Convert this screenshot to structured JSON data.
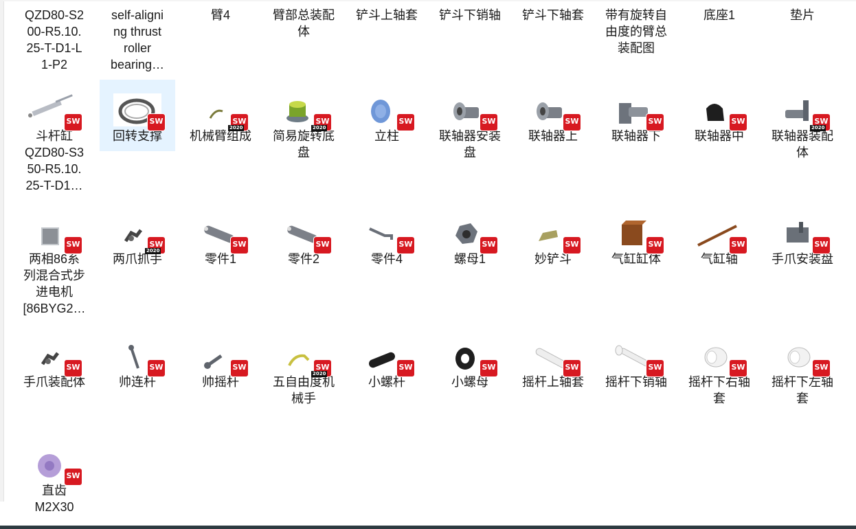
{
  "files": [
    {
      "label": "QZD80-S200-R5.10.25-T-D1-L1-P2",
      "display": "QZD80-S2\n00-R5.10.\n25-T-D1-L\n1-P2",
      "thumb": "none",
      "badge": "",
      "row": 0,
      "col": 0
    },
    {
      "label": "self-aligning thrust roller bearing…",
      "display": "self-aligni\nng thrust\nroller\nbearing…",
      "thumb": "none",
      "badge": "",
      "row": 0,
      "col": 1
    },
    {
      "label": "臂4",
      "display": "臂4",
      "thumb": "none",
      "badge": "",
      "row": 0,
      "col": 2
    },
    {
      "label": "臂部总装配体",
      "display": "臂部总装配\n体",
      "thumb": "none",
      "badge": "",
      "row": 0,
      "col": 3
    },
    {
      "label": "铲斗上轴套",
      "display": "铲斗上轴套",
      "thumb": "none",
      "badge": "",
      "row": 0,
      "col": 4
    },
    {
      "label": "铲斗下销轴",
      "display": "铲斗下销轴",
      "thumb": "none",
      "badge": "",
      "row": 0,
      "col": 5
    },
    {
      "label": "铲斗下轴套",
      "display": "铲斗下轴套",
      "thumb": "none",
      "badge": "",
      "row": 0,
      "col": 6
    },
    {
      "label": "带有旋转自由度的臂总装配图",
      "display": "带有旋转自\n由度的臂总\n装配图",
      "thumb": "none",
      "badge": "",
      "row": 0,
      "col": 7
    },
    {
      "label": "底座1",
      "display": "底座1",
      "thumb": "none",
      "badge": "",
      "row": 0,
      "col": 8
    },
    {
      "label": "垫片",
      "display": "垫片",
      "thumb": "none",
      "badge": "",
      "row": 0,
      "col": 9
    },
    {
      "label": "斗杆缸QZD80-S350-R5.10.25-T-D1…",
      "display": "斗杆缸\nQZD80-S3\n50-R5.10.\n25-T-D1…",
      "thumb": "cylinder-rod",
      "badge": "",
      "row": 1,
      "col": 0
    },
    {
      "label": "回转支撑",
      "display": "回转支撑",
      "thumb": "ring",
      "badge": "",
      "row": 1,
      "col": 1,
      "selected": true
    },
    {
      "label": "机械臂组成",
      "display": "机械臂组成",
      "thumb": "arm-thin",
      "badge": "2020",
      "row": 1,
      "col": 2
    },
    {
      "label": "简易旋转底盘",
      "display": "简易旋转底\n盘",
      "thumb": "base-green",
      "badge": "2020",
      "row": 1,
      "col": 3
    },
    {
      "label": "立柱",
      "display": "立柱",
      "thumb": "disc-blue",
      "badge": "",
      "row": 1,
      "col": 4
    },
    {
      "label": "联轴器安装盘",
      "display": "联轴器安装\n盘",
      "thumb": "coupling",
      "badge": "",
      "row": 1,
      "col": 5
    },
    {
      "label": "联轴器上",
      "display": "联轴器上",
      "thumb": "coupling",
      "badge": "",
      "row": 1,
      "col": 6
    },
    {
      "label": "联轴器下",
      "display": "联轴器下",
      "thumb": "coupling-plate",
      "badge": "",
      "row": 1,
      "col": 7
    },
    {
      "label": "联轴器中",
      "display": "联轴器中",
      "thumb": "coupling-black",
      "badge": "",
      "row": 1,
      "col": 8
    },
    {
      "label": "联轴器装配体",
      "display": "联轴器装配\n体",
      "thumb": "coupling-assembly",
      "badge": "2020",
      "row": 1,
      "col": 9
    },
    {
      "label": "两相86系列混合式步进电机[86BYG2…",
      "display": "两相86系\n列混合式步\n进电机\n[86BYG2…",
      "thumb": "motor",
      "badge": "",
      "row": 2,
      "col": 0
    },
    {
      "label": "两爪抓手",
      "display": "两爪抓手",
      "thumb": "gripper",
      "badge": "2020",
      "row": 2,
      "col": 1
    },
    {
      "label": "零件1",
      "display": "零件1",
      "thumb": "link-bar",
      "badge": "",
      "row": 2,
      "col": 2
    },
    {
      "label": "零件2",
      "display": "零件2",
      "thumb": "link-bar",
      "badge": "",
      "row": 2,
      "col": 3
    },
    {
      "label": "零件4",
      "display": "零件4",
      "thumb": "bent-plate",
      "badge": "",
      "row": 2,
      "col": 4
    },
    {
      "label": "螺母1",
      "display": "螺母1",
      "thumb": "hex-nut",
      "badge": "",
      "row": 2,
      "col": 5
    },
    {
      "label": "妙铲斗",
      "display": "妙铲斗",
      "thumb": "bucket",
      "badge": "",
      "row": 2,
      "col": 6
    },
    {
      "label": "气缸缸体",
      "display": "气缸缸体",
      "thumb": "brown-block",
      "badge": "",
      "row": 2,
      "col": 7
    },
    {
      "label": "气缸轴",
      "display": "气缸轴",
      "thumb": "brown-rod",
      "badge": "",
      "row": 2,
      "col": 8
    },
    {
      "label": "手爪安装盘",
      "display": "手爪安装盘",
      "thumb": "mount-plate",
      "badge": "",
      "row": 2,
      "col": 9
    },
    {
      "label": "手爪装配体",
      "display": "手爪装配体",
      "thumb": "gripper",
      "badge": "",
      "row": 3,
      "col": 0
    },
    {
      "label": "帅连杆",
      "display": "帅连杆",
      "thumb": "rod-link",
      "badge": "",
      "row": 3,
      "col": 1
    },
    {
      "label": "帅摇杆",
      "display": "帅摇杆",
      "thumb": "rocker",
      "badge": "",
      "row": 3,
      "col": 2
    },
    {
      "label": "五自由度机械手",
      "display": "五自由度机\n械手",
      "thumb": "arm-yellow",
      "badge": "2020",
      "row": 3,
      "col": 3
    },
    {
      "label": "小螺杆",
      "display": "小螺杆",
      "thumb": "black-bolt",
      "badge": "",
      "row": 3,
      "col": 4
    },
    {
      "label": "小螺母",
      "display": "小螺母",
      "thumb": "black-ring",
      "badge": "",
      "row": 3,
      "col": 5
    },
    {
      "label": "摇杆上轴套",
      "display": "摇杆上轴套",
      "thumb": "white-tube",
      "badge": "",
      "row": 3,
      "col": 6
    },
    {
      "label": "摇杆下销轴",
      "display": "摇杆下销轴",
      "thumb": "white-pin",
      "badge": "",
      "row": 3,
      "col": 7
    },
    {
      "label": "摇杆下右轴套",
      "display": "摇杆下右轴\n套",
      "thumb": "white-sleeve",
      "badge": "",
      "row": 3,
      "col": 8
    },
    {
      "label": "摇杆下左轴套",
      "display": "摇杆下左轴\n套",
      "thumb": "white-sleeve",
      "badge": "",
      "row": 3,
      "col": 9
    },
    {
      "label": "直齿M2X30",
      "display": "直齿\nM2X30",
      "thumb": "gear",
      "badge": "",
      "row": 4,
      "col": 0
    }
  ],
  "icons": {
    "sw_badge_text": "SW",
    "file_type_icon": "solidworks-file-icon"
  },
  "colors": {
    "selection": "#cce8ff",
    "sw_red": "#d71921",
    "taskbar": "#2d3b41"
  }
}
